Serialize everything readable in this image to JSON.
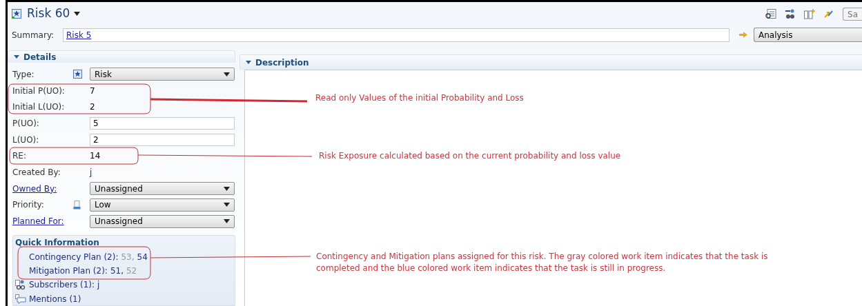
{
  "editor": {
    "title": "Risk 60",
    "toolbar_button": "Sa"
  },
  "summary": {
    "label": "Summary:",
    "value": "Risk 5",
    "state_label": "Analysis"
  },
  "details": {
    "title": "Details",
    "fields": [
      {
        "label": "Type:",
        "label_link": false,
        "kind": "dropdown",
        "value": "Risk"
      },
      {
        "label": "Initial P(UO):",
        "label_link": false,
        "kind": "text",
        "value": "7"
      },
      {
        "label": "Initial L(UO):",
        "label_link": false,
        "kind": "text",
        "value": "2"
      },
      {
        "label": "P(UO):",
        "label_link": false,
        "kind": "input",
        "value": "5"
      },
      {
        "label": "L(UO):",
        "label_link": false,
        "kind": "input",
        "value": "2"
      },
      {
        "label": "RE:",
        "label_link": false,
        "kind": "text",
        "value": "14"
      },
      {
        "label": "Created By:",
        "label_link": false,
        "kind": "link",
        "value": "j"
      },
      {
        "label": "Owned By:",
        "label_link": true,
        "kind": "dropdown",
        "value": "Unassigned"
      },
      {
        "label": "Priority:",
        "label_link": false,
        "kind": "dropdown",
        "value": "Low"
      },
      {
        "label": "Planned For:",
        "label_link": true,
        "kind": "dropdown",
        "value": "Unassigned"
      }
    ]
  },
  "quick_information": {
    "title": "Quick Information",
    "plans": [
      {
        "label": "Contingency Plan (2):",
        "items": [
          {
            "text": "53,",
            "completed": true
          },
          {
            "text": "54",
            "completed": false
          }
        ]
      },
      {
        "label": "Mitigation Plan (2):",
        "items": [
          {
            "text": "51,",
            "completed": false
          },
          {
            "text": "52",
            "completed": true
          }
        ]
      }
    ],
    "others": [
      {
        "kind": "subscribers",
        "label": "Subscribers (1):",
        "value": "j"
      },
      {
        "kind": "mentions",
        "label": "Mentions (1)"
      }
    ]
  },
  "description": {
    "title": "Description"
  },
  "annotations": [
    {
      "text": "Read only Values of the initial Probability and Loss"
    },
    {
      "text": "Risk Exposure calculated based on the current probability and loss value"
    },
    {
      "text": "Contingency and Mitigation plans assigned for this risk. The gray colored work item indicates that the task is completed and the blue colored work item indicates that the task is still in progress."
    }
  ]
}
